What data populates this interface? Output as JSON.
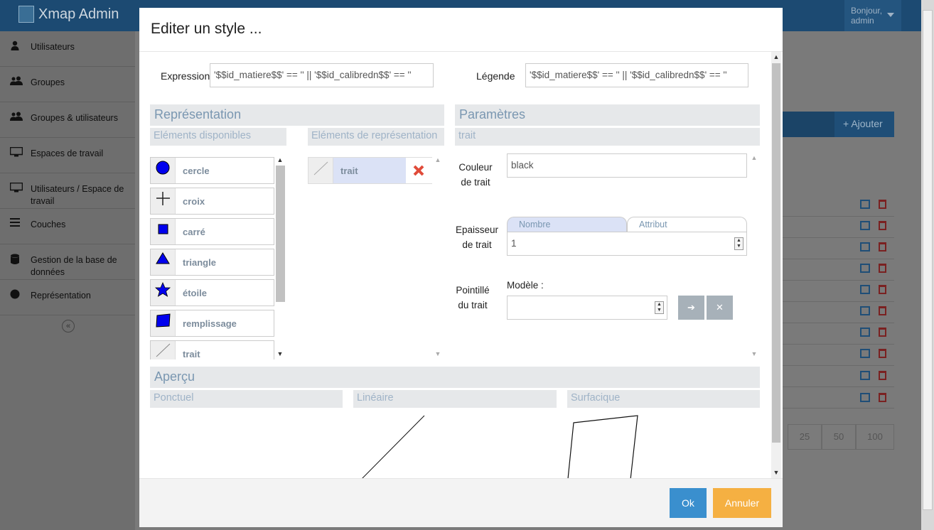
{
  "app": {
    "brand": "Xmap Admin",
    "greeting": "Bonjour,",
    "username": "admin"
  },
  "sidebar": {
    "items": [
      {
        "label": "Utilisateurs",
        "icon": "user-icon"
      },
      {
        "label": "Groupes",
        "icon": "users-icon"
      },
      {
        "label": "Groupes & utilisateurs",
        "icon": "users-icon"
      },
      {
        "label": "Espaces de travail",
        "icon": "monitor-icon"
      },
      {
        "label": "Utilisateurs / Espace de travail",
        "icon": "monitor-icon"
      },
      {
        "label": "Couches",
        "icon": "list-icon"
      },
      {
        "label": "Gestion de la base de données",
        "icon": "database-icon"
      },
      {
        "label": "Représentation",
        "icon": "circle-icon"
      }
    ]
  },
  "background": {
    "add_label": "Ajouter",
    "pager": [
      "25",
      "50",
      "100"
    ]
  },
  "modal": {
    "title": "Editer un style ...",
    "expression_label": "Expression",
    "expression_value": "'$$id_matiere$$' == '' || '$$id_calibredn$$' == ''",
    "legend_label": "Légende",
    "legend_value": "'$$id_matiere$$' == '' || '$$id_calibredn$$' == ''",
    "representation": {
      "title": "Représentation",
      "available_title": "Eléments disponibles",
      "elements_title": "Eléments de représentation",
      "available": [
        {
          "label": "cercle",
          "icon": "circle-symbol-icon"
        },
        {
          "label": "croix",
          "icon": "cross-symbol-icon"
        },
        {
          "label": "carré",
          "icon": "square-symbol-icon"
        },
        {
          "label": "triangle",
          "icon": "triangle-symbol-icon"
        },
        {
          "label": "étoile",
          "icon": "star-symbol-icon"
        },
        {
          "label": "remplissage",
          "icon": "fill-symbol-icon"
        },
        {
          "label": "trait",
          "icon": "line-symbol-icon"
        }
      ],
      "selected": [
        {
          "label": "trait",
          "icon": "line-symbol-icon"
        }
      ]
    },
    "parametres": {
      "title": "Paramètres",
      "subtitle": "trait",
      "color_label": "Couleur de trait",
      "color_value": "black",
      "width_label": "Epaisseur de trait",
      "tab_number": "Nombre",
      "tab_attribute": "Attribut",
      "width_value": "1",
      "dash_label": "Pointillé du trait",
      "model_label": "Modèle :",
      "model_value": ""
    },
    "apercu": {
      "title": "Aperçu",
      "ponctuel": "Ponctuel",
      "lineaire": "Linéaire",
      "surfacique": "Surfacique"
    },
    "ok_label": "Ok",
    "cancel_label": "Annuler"
  },
  "colors": {
    "accent_blue": "#3a8fce",
    "cancel_orange": "#f5b042",
    "symbol_blue": "#0000ee",
    "delete_red": "#e04b3a"
  }
}
